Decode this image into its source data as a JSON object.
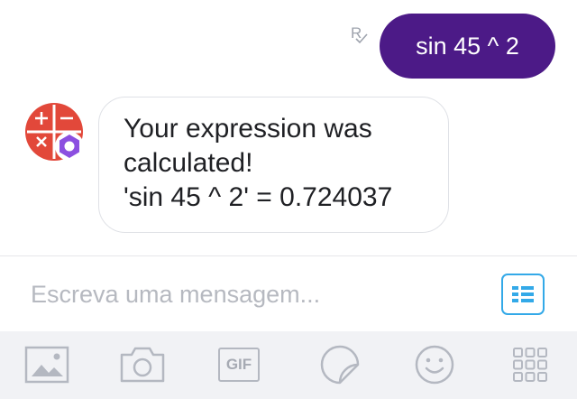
{
  "conversation": {
    "outgoing_message": "sin 45 ^ 2",
    "receipt_letter": "R",
    "incoming_message": {
      "lines": [
        "Your expression was",
        "calculated!",
        "'sin 45 ^ 2' = 0.724037"
      ]
    },
    "bot_avatar_icon": "calculator-icon"
  },
  "composer": {
    "placeholder": "Escreva uma mensagem...",
    "value": "",
    "keyboard_icon": "keyboard-icon"
  },
  "toolbar": {
    "items": [
      {
        "icon": "image-icon"
      },
      {
        "icon": "camera-icon"
      },
      {
        "icon": "gif-icon",
        "label": "GIF"
      },
      {
        "icon": "sticker-icon"
      },
      {
        "icon": "emoji-icon"
      },
      {
        "icon": "apps-grid-icon"
      }
    ]
  },
  "colors": {
    "outgoing_bubble": "#4c1a87",
    "accent_blue": "#33a9e8",
    "avatar_red": "#e2483a",
    "avatar_badge": "#8c4fe0",
    "toolbar_bg": "#f1f2f5",
    "icon_gray": "#b4b8c1"
  }
}
